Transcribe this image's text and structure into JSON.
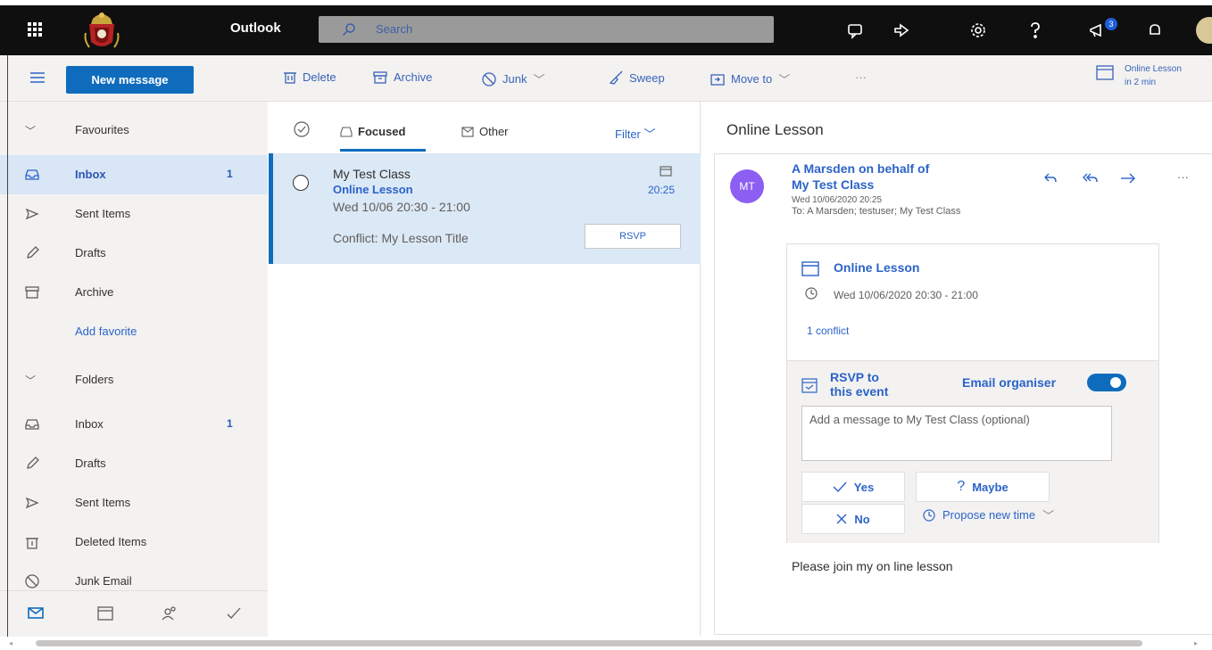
{
  "topbar": {
    "app_name": "Outlook",
    "search_placeholder": "Search",
    "notification_count": "3"
  },
  "commands": {
    "new_message": "New message",
    "delete": "Delete",
    "archive": "Archive",
    "junk": "Junk",
    "sweep": "Sweep",
    "move_to": "Move to",
    "more": "···",
    "reminder_title": "Online Lesson",
    "reminder_sub": "in 2 min"
  },
  "nav": {
    "favourites": "Favourites",
    "favourite_items": [
      {
        "label": "Inbox",
        "count": "1",
        "icon": "inbox-icon"
      },
      {
        "label": "Sent Items",
        "icon": "send-icon"
      },
      {
        "label": "Drafts",
        "icon": "pencil-icon"
      },
      {
        "label": "Archive",
        "icon": "archive-icon"
      }
    ],
    "add_favorite": "Add favorite",
    "folders": "Folders",
    "folder_items": [
      {
        "label": "Inbox",
        "count": "1",
        "icon": "inbox-icon"
      },
      {
        "label": "Drafts",
        "icon": "pencil-icon"
      },
      {
        "label": "Sent Items",
        "icon": "send-icon"
      },
      {
        "label": "Deleted Items",
        "icon": "trash-icon"
      },
      {
        "label": "Junk Email",
        "icon": "block-icon"
      }
    ]
  },
  "list": {
    "tab_focused": "Focused",
    "tab_other": "Other",
    "filter": "Filter",
    "message": {
      "sender": "My Test Class",
      "subject": "Online Lesson",
      "when": "Wed 10/06 20:30 - 21:00",
      "conflict": "Conflict: My Lesson Title",
      "time": "20:25",
      "rsvp": "RSVP"
    }
  },
  "reading": {
    "title": "Online Lesson",
    "avatar_initials": "MT",
    "from_line1": "A Marsden on behalf of",
    "from_line2": "My Test Class",
    "sent": "Wed 10/06/2020 20:25",
    "to": "To: A Marsden; testuser; My Test Class",
    "event_title": "Online Lesson",
    "event_time": "Wed 10/06/2020 20:30 - 21:00",
    "conflicts": "1 conflict",
    "rsvp_label": "RSVP to this event",
    "email_organiser": "Email organiser",
    "message_placeholder": "Add a message to My Test Class (optional)",
    "yes": "Yes",
    "maybe": "Maybe",
    "no": "No",
    "propose": "Propose new time",
    "body": "Please join my on line lesson"
  },
  "colors": {
    "accent": "#0f6cbd",
    "link": "#2b63c8",
    "avatar": "#8c5ff2"
  }
}
